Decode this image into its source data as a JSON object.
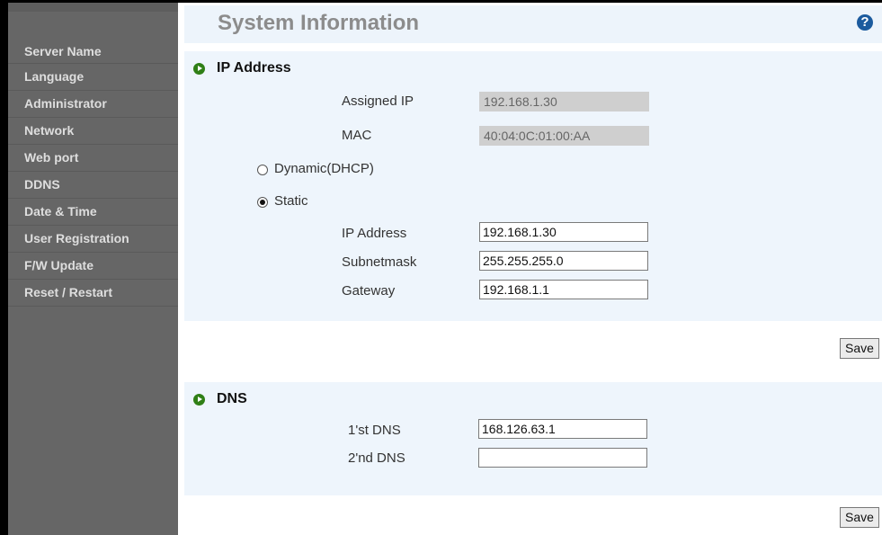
{
  "sidebar": {
    "items": [
      {
        "label": "Server Name"
      },
      {
        "label": "Language"
      },
      {
        "label": "Administrator"
      },
      {
        "label": "Network"
      },
      {
        "label": "Web port"
      },
      {
        "label": "DDNS"
      },
      {
        "label": "Date & Time"
      },
      {
        "label": "User Registration"
      },
      {
        "label": "F/W Update"
      },
      {
        "label": "Reset / Restart"
      }
    ]
  },
  "header": {
    "title": "System Information",
    "help_label": "?"
  },
  "ip_section": {
    "title": "IP Address",
    "assigned_ip_label": "Assigned IP",
    "assigned_ip_value": "192.168.1.30",
    "mac_label": "MAC",
    "mac_value": "40:04:0C:01:00:AA",
    "dhcp_label": "Dynamic(DHCP)",
    "static_label": "Static",
    "selected_mode": "Static",
    "ip_address_label": "IP Address",
    "ip_address_value": "192.168.1.30",
    "subnet_label": "Subnetmask",
    "subnet_value": "255.255.255.0",
    "gateway_label": "Gateway",
    "gateway_value": "192.168.1.1",
    "save_label": "Save"
  },
  "dns_section": {
    "title": "DNS",
    "dns1_label": "1'st DNS",
    "dns1_value": "168.126.63.1",
    "dns2_label": "2'nd DNS",
    "dns2_value": "",
    "save_label": "Save"
  },
  "colors": {
    "sidebar_bg": "#666666",
    "panel_bg": "#eef5fc",
    "bullet_green": "#2f7f16",
    "help_blue": "#1c5b9e"
  }
}
